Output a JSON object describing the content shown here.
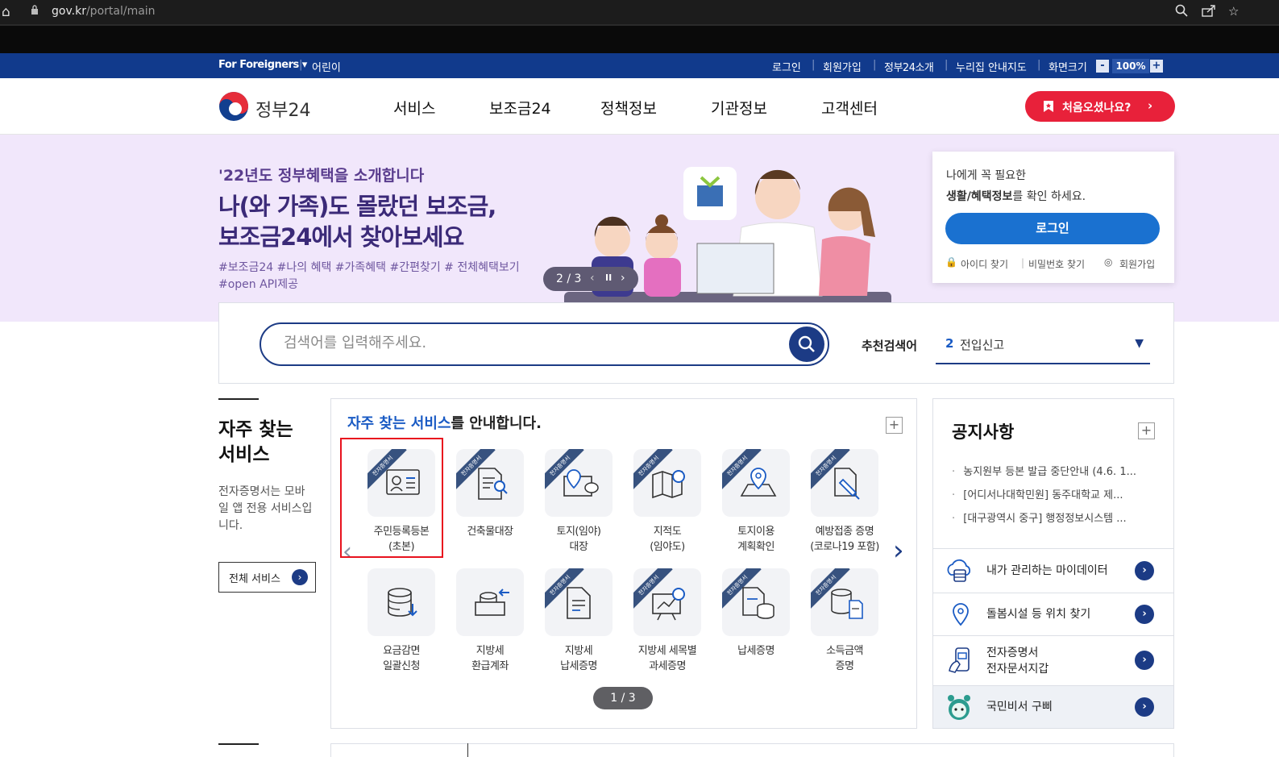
{
  "browser": {
    "url_host": "gov.kr",
    "url_path": "/portal/main"
  },
  "utility_bar": {
    "foreigners": "For Foreigners ▾",
    "kids": "어린이",
    "links": [
      "로그인",
      "회원가입",
      "정부24소개",
      "누리집 안내지도"
    ],
    "zoom_label": "화면크기",
    "zoom_minus": "-",
    "zoom_value": "100%",
    "zoom_plus": "+"
  },
  "header": {
    "logo_text": "정부24",
    "nav": [
      "서비스",
      "보조금24",
      "정책정보",
      "기관정보",
      "고객센터"
    ],
    "first_visit": "처음오셨나요?"
  },
  "hero": {
    "kicker": "'22년도 정부혜택을 소개합니다",
    "headline_1": "나(와 가족)도 몰랐던 보조금,",
    "headline_2": "보조금24에서 찾아보세요",
    "tags_1": "#보조금24 #나의 혜택 #가족혜택 #간편찾기 # 전체혜택보기",
    "tags_2": "#open API제공",
    "pager": "2 / 3"
  },
  "login_card": {
    "line1": "나에게 꼭 필요한",
    "line2_bold": "생활/혜택정보",
    "line2_rest": "를 확인 하세요.",
    "button": "로그인",
    "find_id": "아이디 찾기",
    "find_pw": "비밀번호 찾기",
    "signup": "회원가입"
  },
  "search": {
    "placeholder": "검색어를 입력해주세요.",
    "recommend_label": "추천검색어",
    "recommend_rank": "2",
    "recommend_value": "전입신고"
  },
  "freq_left": {
    "title": "자주 찾는 서비스",
    "desc": "전자증명서는 모바일 앱 전용 서비스입니다.",
    "all_button": "전체 서비스"
  },
  "services": {
    "heading_highlight": "자주 찾는 서비스",
    "heading_rest": "를 안내합니다.",
    "ribbon_text": "전자증명서",
    "tiles": [
      {
        "label_1": "주민등록등본",
        "label_2": "(초본)",
        "icon": "id-card-icon"
      },
      {
        "label_1": "건축물대장",
        "label_2": "",
        "icon": "document-search-icon"
      },
      {
        "label_1": "토지(임야)",
        "label_2": "대장",
        "icon": "land-map-icon"
      },
      {
        "label_1": "지적도",
        "label_2": "(임야도)",
        "icon": "map-search-icon"
      },
      {
        "label_1": "토지이용",
        "label_2": "계획확인",
        "icon": "location-map-icon"
      },
      {
        "label_1": "예방접종 증명",
        "label_2": "(코로나19 포함)",
        "icon": "syringe-icon"
      },
      {
        "label_1": "요금감면",
        "label_2": "일괄신청",
        "icon": "database-download-icon"
      },
      {
        "label_1": "지방세",
        "label_2": "환급계좌",
        "icon": "account-refund-icon"
      },
      {
        "label_1": "지방세",
        "label_2": "납세증명",
        "icon": "document-icon"
      },
      {
        "label_1": "지방세 세목별",
        "label_2": "과세증명",
        "icon": "chart-search-icon"
      },
      {
        "label_1": "납세증명",
        "label_2": "",
        "icon": "tax-doc-icon"
      },
      {
        "label_1": "소득금액",
        "label_2": "증명",
        "icon": "income-doc-icon"
      }
    ],
    "pager": "1 / 3"
  },
  "notices": {
    "title": "공지사항",
    "items": [
      "농지원부 등본 발급 중단안내 (4.6. 1...",
      "[어디서나대학민원] 동주대학교 제...",
      "[대구광역시 중구] 행정정보시스템 ..."
    ]
  },
  "quick_links": [
    {
      "label_1": "내가 관리하는 마이데이터",
      "label_2": "",
      "icon": "cloud-data-icon"
    },
    {
      "label_1": "돌봄시설 등 위치 찾기",
      "label_2": "",
      "icon": "location-pin-icon"
    },
    {
      "label_1": "전자증명서",
      "label_2": "전자문서지갑",
      "icon": "phone-wallet-icon"
    },
    {
      "label_1": "국민비서 구삐",
      "label_2": "",
      "icon": "gubbi-mascot-icon"
    }
  ],
  "colors": {
    "navy": "#113a8c",
    "brand_blue": "#1c3b85",
    "hero_bg": "#f1e7fb",
    "accent_red": "#e8213a",
    "highlight_red": "#e8121e"
  }
}
